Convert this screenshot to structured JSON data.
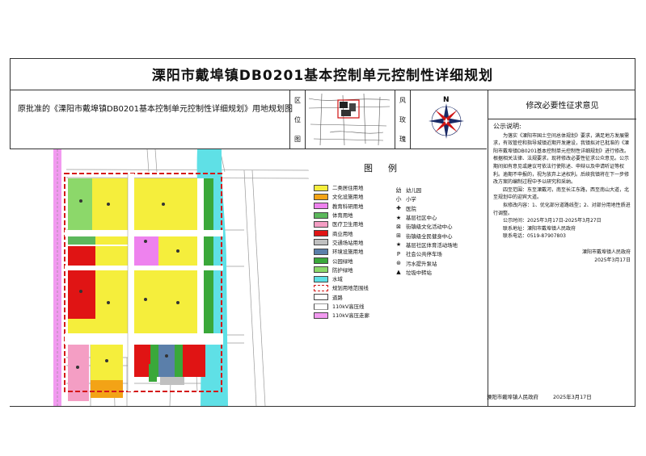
{
  "title": "溧阳市戴埠镇DB0201基本控制单元控制性详细规划",
  "subtitle": "原批准的《溧阳市戴埠镇DB0201基本控制单元控制性详细规划》用地规划图",
  "location_label": [
    "区",
    "位",
    "图"
  ],
  "wind_label": [
    "风",
    "玫",
    "瑰"
  ],
  "compass_letter": "N",
  "legend_title": "图　例",
  "legend": [
    {
      "label": "二类居住用地",
      "color": "#f5ee3c"
    },
    {
      "label": "文化设施用地",
      "color": "#f3a316"
    },
    {
      "label": "教育科研用地",
      "color": "#ee82ee"
    },
    {
      "label": "体育用地",
      "color": "#5cb85c"
    },
    {
      "label": "医疗卫生用地",
      "color": "#f49ec4"
    },
    {
      "label": "商业用地",
      "color": "#e01414"
    },
    {
      "label": "交通场站用地",
      "color": "#c0c0c0"
    },
    {
      "label": "环境设施用地",
      "color": "#5b7faa"
    },
    {
      "label": "公园绿地",
      "color": "#3aa83a"
    },
    {
      "label": "防护绿地",
      "color": "#8cd86a"
    },
    {
      "label": "水域",
      "color": "#5fe0e6"
    },
    {
      "label": "规划用地范围线",
      "color": "#d41818"
    },
    {
      "label": "道路",
      "color": "#ffffff"
    },
    {
      "label": "110kV高压线",
      "color": "#999999"
    },
    {
      "label": "110kV高压走廊",
      "color": "#f29af0"
    }
  ],
  "legend_symbols": [
    {
      "symbol": "幼",
      "label": "幼儿园"
    },
    {
      "symbol": "小",
      "label": "小学"
    },
    {
      "symbol": "✚",
      "label": "医院"
    },
    {
      "symbol": "★",
      "label": "基层社区中心"
    },
    {
      "symbol": "⊠",
      "label": "街镇级文化活动中心"
    },
    {
      "symbol": "⊞",
      "label": "街镇级全民健身中心"
    },
    {
      "symbol": "★",
      "label": "基层社区体育活动场地"
    },
    {
      "symbol": "P",
      "label": "社会公共停车场"
    },
    {
      "symbol": "⊛",
      "label": "污水提升泵站"
    },
    {
      "symbol": "▲",
      "label": "垃圾中转站"
    }
  ],
  "notice": {
    "title": "修改必要性征求意见",
    "heading": "公示说明:",
    "paragraphs": [
      "为落实《溧阳市国土空间总体规划》要求，满足地方发展需求，有效管控和指导城镇近期开发建设，我镇拟对已批准的《溧阳市戴埠镇DB0201基本控制单元控制性详细规划》进行修改。根据相关法律、法规要求，现将修改必要性征求公众意见。公示期间如有意见或建议可依法行使陈述、申辩以及申请听证等权利。逾期不申报的，视为放弃上述权利。后续我镇将在下一步修改方案的编制过程中予以研究和采纳。",
      "四至范围：东至溧戴河，南至长江东路，西至南山大道，北至规划中的迎宾大道。",
      "拟修改内容：1、优化部分道路线型；2、对部分用地性质进行调整。"
    ],
    "period": "公示时间：2025年3月17日-2025年3月27日",
    "contact": "联系地址：溧阳市戴埠镇人民政府",
    "phone": "联系电话：0519-87907803",
    "sign_org": "溧阳市戴埠镇人民政府",
    "sign_date": "2025年3月17日"
  },
  "footer": {
    "org": "溧阳市戴埠镇人民政府",
    "date": "2025年3月17日"
  }
}
